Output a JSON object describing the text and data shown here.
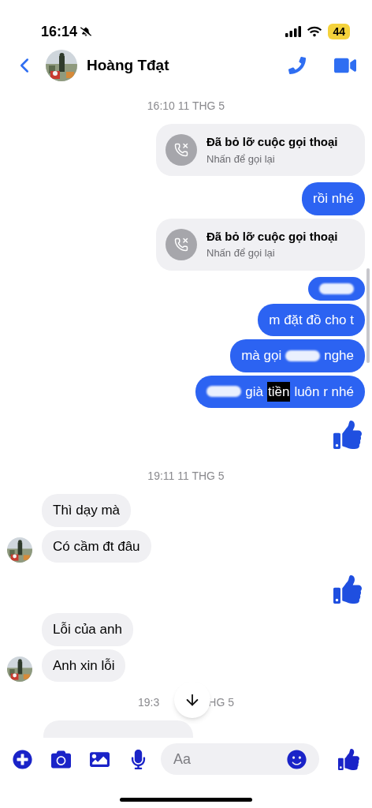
{
  "status_bar": {
    "time": "16:14",
    "battery": "44"
  },
  "header": {
    "name": "Hoàng Tđạt"
  },
  "messages": [
    {
      "kind": "time",
      "text": "16:10 11 THG 5"
    },
    {
      "kind": "missed_call",
      "title": "Đã bỏ lỡ cuộc gọi thoại",
      "subtitle": "Nhấn để gọi lại"
    },
    {
      "kind": "text",
      "outgoing": true,
      "segments": [
        {
          "kind": "text",
          "text": "rồi nhé",
          "selected": false
        }
      ]
    },
    {
      "kind": "missed_call",
      "title": "Đã bỏ lỡ cuộc gọi thoại",
      "subtitle": "Nhấn để gọi lại"
    },
    {
      "kind": "text",
      "outgoing": true,
      "segments": [
        {
          "kind": "redacted"
        }
      ]
    },
    {
      "kind": "text",
      "outgoing": true,
      "segments": [
        {
          "kind": "text",
          "text": "m đặt đồ cho t",
          "selected": false
        }
      ]
    },
    {
      "kind": "text",
      "outgoing": true,
      "segments": [
        {
          "kind": "text",
          "text": "mà gọi",
          "selected": false
        },
        {
          "kind": "redacted"
        },
        {
          "kind": "text",
          "text": "nghe",
          "selected": false
        }
      ]
    },
    {
      "kind": "text",
      "outgoing": true,
      "segments": [
        {
          "kind": "redacted"
        },
        {
          "kind": "text",
          "text": "già",
          "selected": false
        },
        {
          "kind": "text",
          "text": "tiền",
          "selected": true
        },
        {
          "kind": "text",
          "text": "luôn r nhé",
          "selected": false
        }
      ]
    },
    {
      "kind": "like"
    },
    {
      "kind": "time",
      "text": "19:11 11 THG 5"
    },
    {
      "kind": "text",
      "outgoing": false,
      "avatar": false,
      "segments": [
        {
          "kind": "text",
          "text": "Thì dạy mà",
          "selected": false
        }
      ]
    },
    {
      "kind": "text",
      "outgoing": false,
      "avatar": true,
      "segments": [
        {
          "kind": "text",
          "text": "Có cầm đt đâu",
          "selected": false
        }
      ]
    },
    {
      "kind": "like"
    },
    {
      "kind": "text",
      "outgoing": false,
      "avatar": false,
      "segments": [
        {
          "kind": "text",
          "text": "Lỗi của anh",
          "selected": false
        }
      ]
    },
    {
      "kind": "text",
      "outgoing": false,
      "avatar": true,
      "segments": [
        {
          "kind": "text",
          "text": "Anh xin lỗi",
          "selected": false
        }
      ]
    },
    {
      "kind": "time_split",
      "left": "19:3",
      "right": "HG 5"
    },
    {
      "kind": "cut",
      "outgoing": false
    }
  ],
  "composer": {
    "placeholder": "Aa"
  }
}
